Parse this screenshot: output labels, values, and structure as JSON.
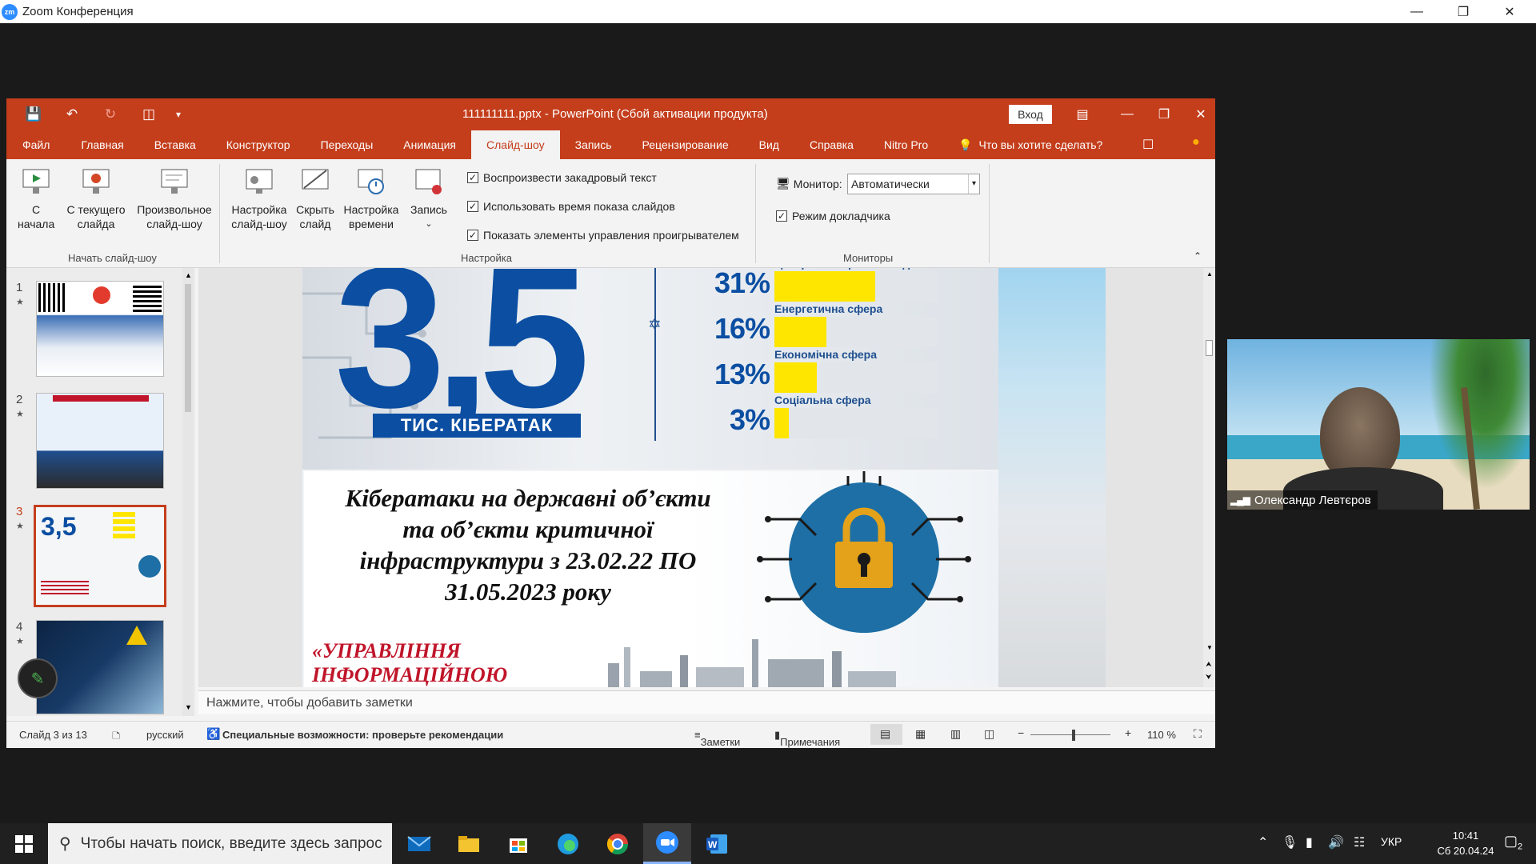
{
  "zoom": {
    "title": "Zoom Конференция",
    "logo": "zm"
  },
  "ppt": {
    "title": "111111111.pptx  -  PowerPoint (Сбой активации продукта)",
    "login": "Вход",
    "tabs": [
      "Файл",
      "Главная",
      "Вставка",
      "Конструктор",
      "Переходы",
      "Анимация",
      "Слайд-шоу",
      "Запись",
      "Рецензирование",
      "Вид",
      "Справка",
      "Nitro Pro"
    ],
    "active_tab": "Слайд-шоу",
    "tell_me": "Что вы хотите сделать?",
    "ribbon": {
      "from_start": "С\nначала",
      "from_current": "С текущего\nслайда",
      "custom_show": "Произвольное\nслайд-шоу",
      "group_start": "Начать слайд-шоу",
      "setup_show": "Настройка\nслайд-шоу",
      "hide_slide": "Скрыть\nслайд",
      "rehearse": "Настройка\nвремени",
      "record": "Запись",
      "cb_narration": "Воспроизвести закадровый текст",
      "cb_timings": "Использовать время показа слайдов",
      "cb_controls": "Показать элементы управления проигрывателем",
      "group_setup": "Настройка",
      "monitor_label": "Монитор:",
      "monitor_value": "Автоматически",
      "presenter_view": "Режим докладчика",
      "group_monitors": "Мониторы"
    },
    "thumbs": [
      "1",
      "2",
      "3",
      "4"
    ],
    "slide": {
      "big_number": "3,5",
      "big_caption": "ТИС. КІБЕРАТАК",
      "bars": [
        {
          "pct": "31%",
          "label": "Центральні органи влади",
          "value": 31
        },
        {
          "pct": "16%",
          "label": "Енергетична сфера",
          "value": 16
        },
        {
          "pct": "13%",
          "label": "Економічна сфера",
          "value": 13
        },
        {
          "pct": "3%",
          "label": "Соціальна сфера",
          "value": 3
        }
      ],
      "headline_1": "Кібератаки на державні об’єкти",
      "headline_2": "та об’єкти критичної",
      "headline_3": "інфраструктури з 23.02.22 ПО",
      "headline_4": "31.05.2023 року",
      "red_1": "«УПРАВЛІННЯ",
      "red_2": "ІНФОРМАЦІЙНОЮ"
    },
    "notes_placeholder": "Нажмите, чтобы добавить заметки",
    "status": {
      "slide": "Слайд 3 из 13",
      "lang": "русский",
      "accessibility": "Специальные возможности: проверьте рекомендации",
      "notes": "Заметки",
      "comments": "Примечания",
      "zoom": "110 %"
    }
  },
  "video": {
    "name": "Олександр Левтєров"
  },
  "taskbar": {
    "search_placeholder": "Чтобы начать поиск, введите здесь запрос",
    "lang": "УКР",
    "time": "10:41",
    "date": "Сб 20.04.24",
    "notif_count": "2"
  },
  "colors": {
    "ppt_accent": "#c43e1c",
    "slide_blue": "#0b4ea2",
    "bar_yellow": "#ffe600",
    "headline_red": "#c0152a"
  }
}
